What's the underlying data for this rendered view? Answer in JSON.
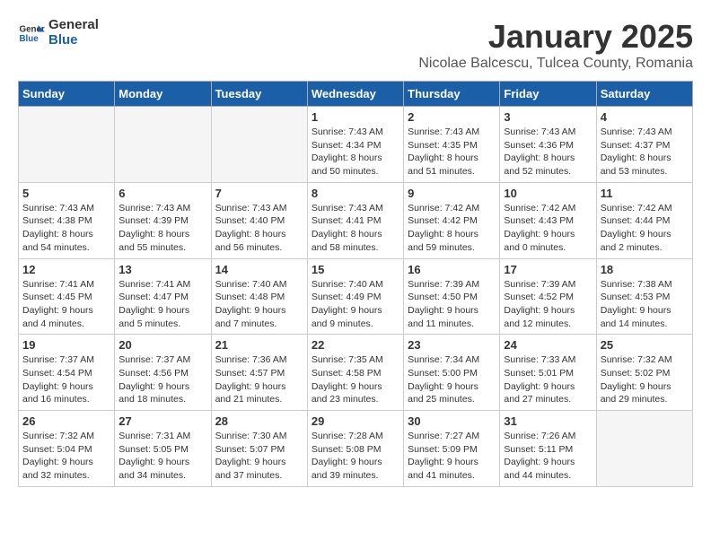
{
  "header": {
    "logo_general": "General",
    "logo_blue": "Blue",
    "title": "January 2025",
    "subtitle": "Nicolae Balcescu, Tulcea County, Romania"
  },
  "weekdays": [
    "Sunday",
    "Monday",
    "Tuesday",
    "Wednesday",
    "Thursday",
    "Friday",
    "Saturday"
  ],
  "weeks": [
    [
      {
        "day": "",
        "info": ""
      },
      {
        "day": "",
        "info": ""
      },
      {
        "day": "",
        "info": ""
      },
      {
        "day": "1",
        "info": "Sunrise: 7:43 AM\nSunset: 4:34 PM\nDaylight: 8 hours\nand 50 minutes."
      },
      {
        "day": "2",
        "info": "Sunrise: 7:43 AM\nSunset: 4:35 PM\nDaylight: 8 hours\nand 51 minutes."
      },
      {
        "day": "3",
        "info": "Sunrise: 7:43 AM\nSunset: 4:36 PM\nDaylight: 8 hours\nand 52 minutes."
      },
      {
        "day": "4",
        "info": "Sunrise: 7:43 AM\nSunset: 4:37 PM\nDaylight: 8 hours\nand 53 minutes."
      }
    ],
    [
      {
        "day": "5",
        "info": "Sunrise: 7:43 AM\nSunset: 4:38 PM\nDaylight: 8 hours\nand 54 minutes."
      },
      {
        "day": "6",
        "info": "Sunrise: 7:43 AM\nSunset: 4:39 PM\nDaylight: 8 hours\nand 55 minutes."
      },
      {
        "day": "7",
        "info": "Sunrise: 7:43 AM\nSunset: 4:40 PM\nDaylight: 8 hours\nand 56 minutes."
      },
      {
        "day": "8",
        "info": "Sunrise: 7:43 AM\nSunset: 4:41 PM\nDaylight: 8 hours\nand 58 minutes."
      },
      {
        "day": "9",
        "info": "Sunrise: 7:42 AM\nSunset: 4:42 PM\nDaylight: 8 hours\nand 59 minutes."
      },
      {
        "day": "10",
        "info": "Sunrise: 7:42 AM\nSunset: 4:43 PM\nDaylight: 9 hours\nand 0 minutes."
      },
      {
        "day": "11",
        "info": "Sunrise: 7:42 AM\nSunset: 4:44 PM\nDaylight: 9 hours\nand 2 minutes."
      }
    ],
    [
      {
        "day": "12",
        "info": "Sunrise: 7:41 AM\nSunset: 4:45 PM\nDaylight: 9 hours\nand 4 minutes."
      },
      {
        "day": "13",
        "info": "Sunrise: 7:41 AM\nSunset: 4:47 PM\nDaylight: 9 hours\nand 5 minutes."
      },
      {
        "day": "14",
        "info": "Sunrise: 7:40 AM\nSunset: 4:48 PM\nDaylight: 9 hours\nand 7 minutes."
      },
      {
        "day": "15",
        "info": "Sunrise: 7:40 AM\nSunset: 4:49 PM\nDaylight: 9 hours\nand 9 minutes."
      },
      {
        "day": "16",
        "info": "Sunrise: 7:39 AM\nSunset: 4:50 PM\nDaylight: 9 hours\nand 11 minutes."
      },
      {
        "day": "17",
        "info": "Sunrise: 7:39 AM\nSunset: 4:52 PM\nDaylight: 9 hours\nand 12 minutes."
      },
      {
        "day": "18",
        "info": "Sunrise: 7:38 AM\nSunset: 4:53 PM\nDaylight: 9 hours\nand 14 minutes."
      }
    ],
    [
      {
        "day": "19",
        "info": "Sunrise: 7:37 AM\nSunset: 4:54 PM\nDaylight: 9 hours\nand 16 minutes."
      },
      {
        "day": "20",
        "info": "Sunrise: 7:37 AM\nSunset: 4:56 PM\nDaylight: 9 hours\nand 18 minutes."
      },
      {
        "day": "21",
        "info": "Sunrise: 7:36 AM\nSunset: 4:57 PM\nDaylight: 9 hours\nand 21 minutes."
      },
      {
        "day": "22",
        "info": "Sunrise: 7:35 AM\nSunset: 4:58 PM\nDaylight: 9 hours\nand 23 minutes."
      },
      {
        "day": "23",
        "info": "Sunrise: 7:34 AM\nSunset: 5:00 PM\nDaylight: 9 hours\nand 25 minutes."
      },
      {
        "day": "24",
        "info": "Sunrise: 7:33 AM\nSunset: 5:01 PM\nDaylight: 9 hours\nand 27 minutes."
      },
      {
        "day": "25",
        "info": "Sunrise: 7:32 AM\nSunset: 5:02 PM\nDaylight: 9 hours\nand 29 minutes."
      }
    ],
    [
      {
        "day": "26",
        "info": "Sunrise: 7:32 AM\nSunset: 5:04 PM\nDaylight: 9 hours\nand 32 minutes."
      },
      {
        "day": "27",
        "info": "Sunrise: 7:31 AM\nSunset: 5:05 PM\nDaylight: 9 hours\nand 34 minutes."
      },
      {
        "day": "28",
        "info": "Sunrise: 7:30 AM\nSunset: 5:07 PM\nDaylight: 9 hours\nand 37 minutes."
      },
      {
        "day": "29",
        "info": "Sunrise: 7:28 AM\nSunset: 5:08 PM\nDaylight: 9 hours\nand 39 minutes."
      },
      {
        "day": "30",
        "info": "Sunrise: 7:27 AM\nSunset: 5:09 PM\nDaylight: 9 hours\nand 41 minutes."
      },
      {
        "day": "31",
        "info": "Sunrise: 7:26 AM\nSunset: 5:11 PM\nDaylight: 9 hours\nand 44 minutes."
      },
      {
        "day": "",
        "info": ""
      }
    ]
  ]
}
